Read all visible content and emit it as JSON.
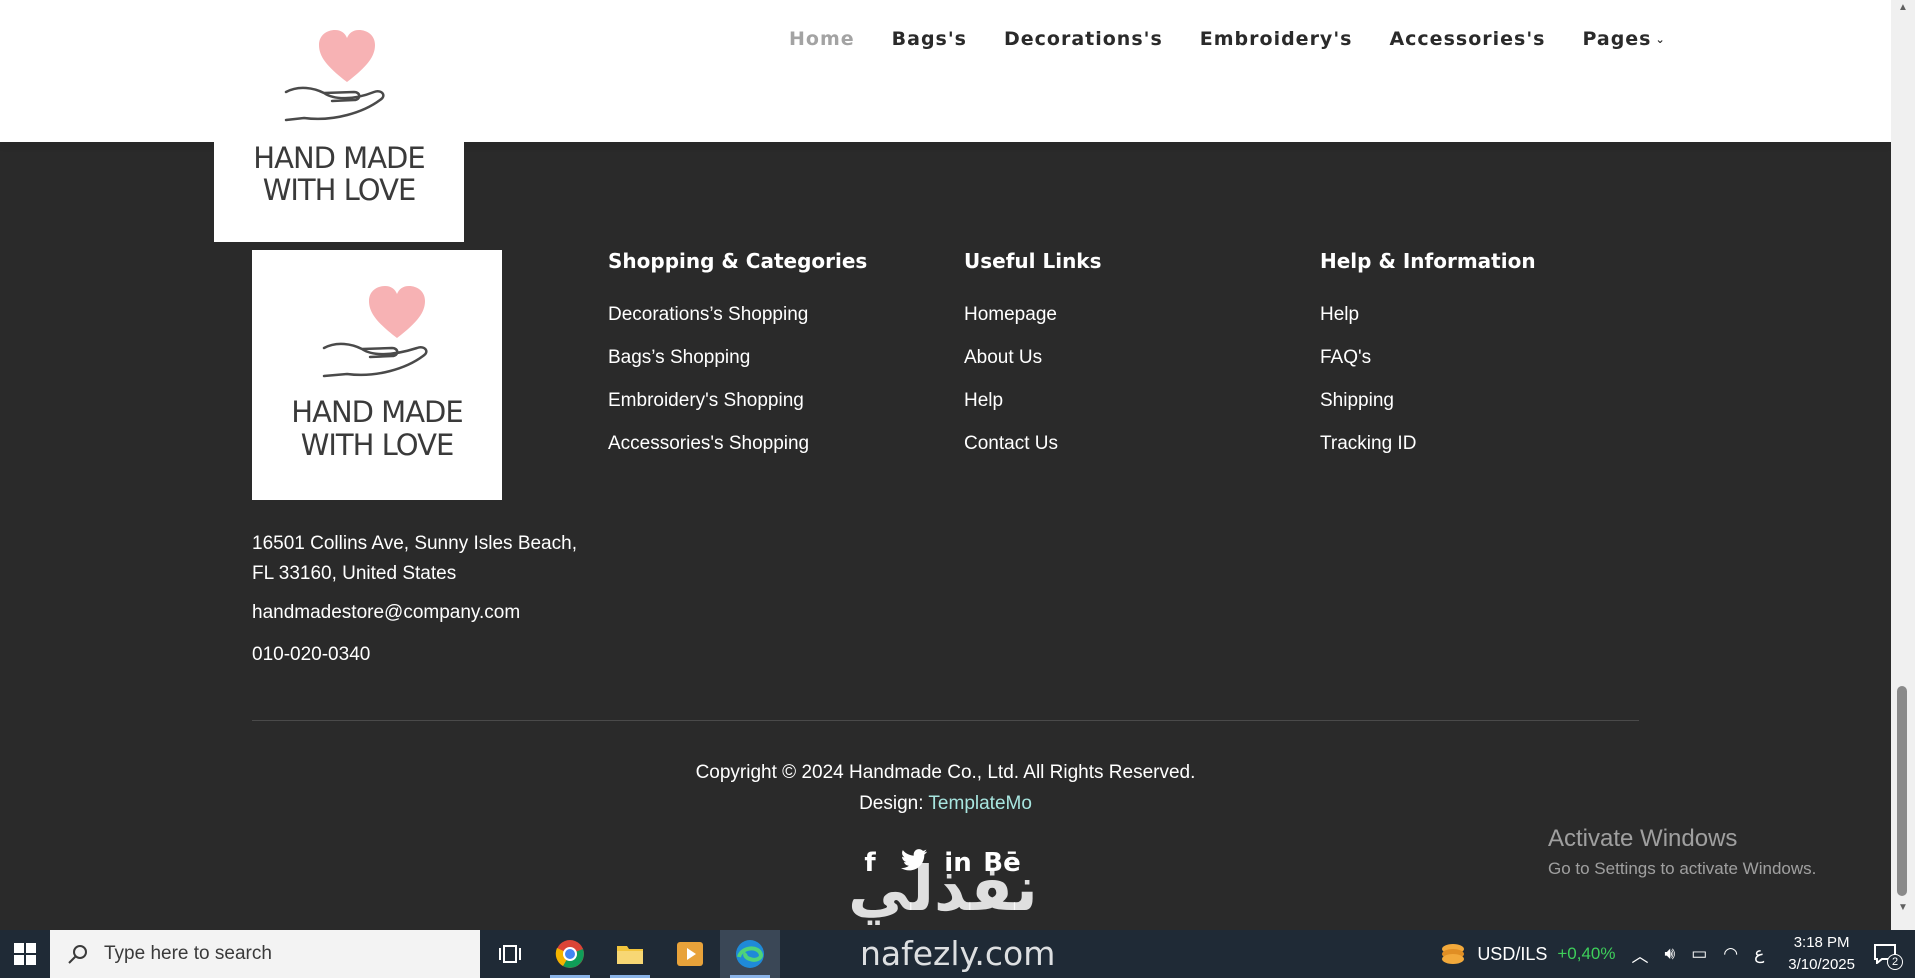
{
  "nav": {
    "items": [
      {
        "label": "Home",
        "active": true
      },
      {
        "label": "Bags's",
        "active": false
      },
      {
        "label": "Decorations's",
        "active": false
      },
      {
        "label": "Embroidery's",
        "active": false
      },
      {
        "label": "Accessories's",
        "active": false
      },
      {
        "label": "Pages",
        "active": false
      }
    ]
  },
  "logo": {
    "line1": "HAND MADE",
    "line2": "WITH LOVE",
    "heart_color": "#f7b2b4"
  },
  "footer": {
    "columns": [
      {
        "title": "Shopping & Categories",
        "links": [
          "Decorations’s Shopping",
          "Bags’s Shopping",
          "Embroidery's Shopping",
          "Accessories's Shopping"
        ]
      },
      {
        "title": "Useful Links",
        "links": [
          "Homepage",
          "About Us",
          "Help",
          "Contact Us"
        ]
      },
      {
        "title": "Help & Information",
        "links": [
          "Help",
          "FAQ's",
          "Shipping",
          "Tracking ID"
        ]
      }
    ],
    "address_line1": "16501 Collins Ave, Sunny Isles Beach,",
    "address_line2": "FL 33160, United States",
    "email": "handmadestore@company.com",
    "phone": "010-020-0340",
    "copyright": "Copyright © 2024 Handmade Co., Ltd. All Rights Reserved.",
    "design_prefix": "Design: ",
    "design_link": "TemplateMo",
    "social": [
      "facebook-icon",
      "twitter-icon",
      "linkedin-icon",
      "behance-icon"
    ]
  },
  "overlay": {
    "watermark_ar": "نفذلي",
    "watermark_en": "nafezly.com",
    "activate_title": "Activate Windows",
    "activate_sub": "Go to Settings to activate Windows."
  },
  "taskbar": {
    "search_placeholder": "Type here to search",
    "ticker_label": "USD/ILS",
    "ticker_change": "+0,40%",
    "lang": "ع",
    "time": "3:18 PM",
    "date": "3/10/2025",
    "notifications": "2"
  }
}
